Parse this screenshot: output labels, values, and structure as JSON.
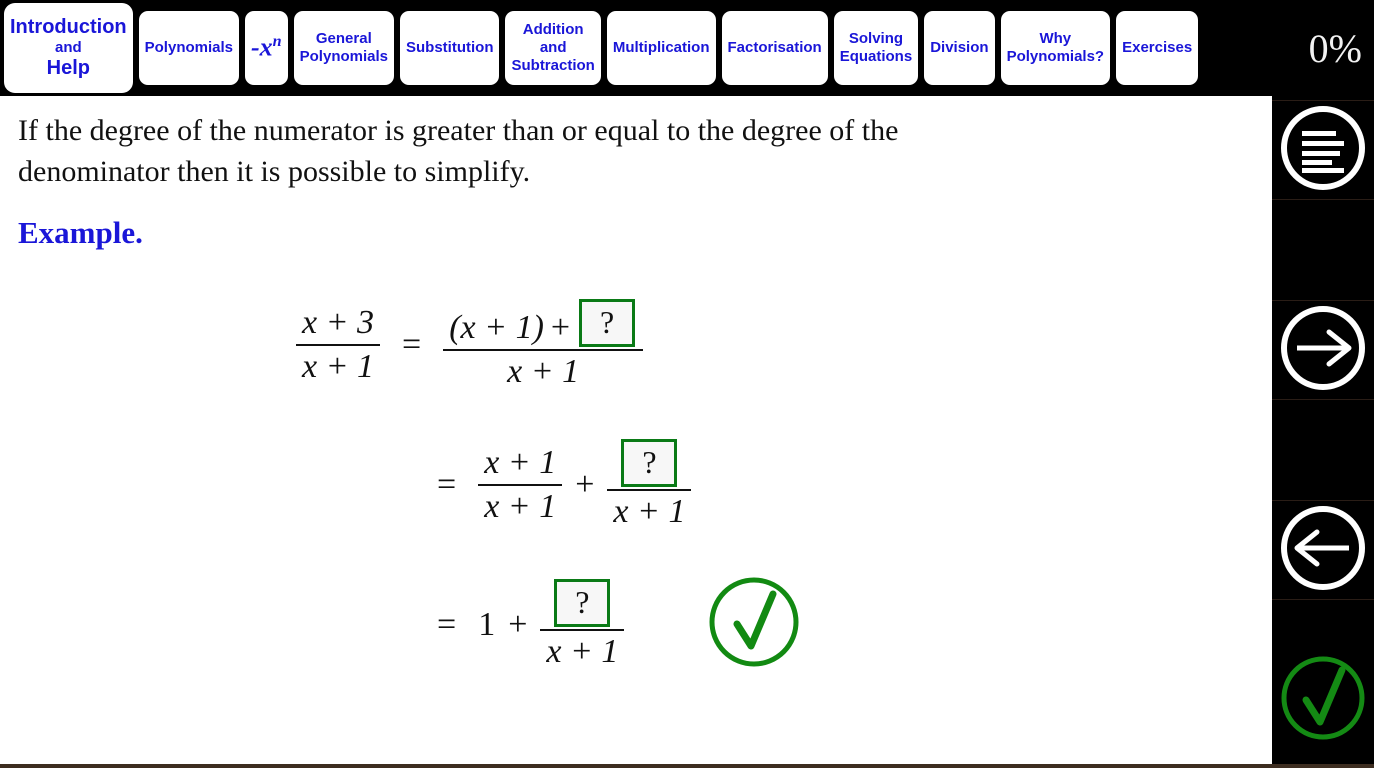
{
  "app": {
    "title": "Polynomials Interactive Lesson",
    "accent_blue": "#1a16d8",
    "accent_green": "#0a7a16",
    "tab_bg": "#ffffff",
    "chrome_bg": "#000000"
  },
  "tabs": [
    {
      "id": "introduction-and-help",
      "lines": [
        "Introduction",
        "and",
        "Help"
      ],
      "active": true,
      "math": false
    },
    {
      "id": "polynomials",
      "lines": [
        "Polynomials"
      ],
      "active": false,
      "math": false
    },
    {
      "id": "negative-x-power-n",
      "lines": [
        "-x"
      ],
      "superscript": "n",
      "active": false,
      "math": true
    },
    {
      "id": "general-polynomials",
      "lines": [
        "General",
        "Polynomials"
      ],
      "active": false,
      "math": false
    },
    {
      "id": "substitution",
      "lines": [
        "Substitution"
      ],
      "active": false,
      "math": false
    },
    {
      "id": "addition-and-subtraction",
      "lines": [
        "Addition",
        "and",
        "Subtraction"
      ],
      "active": false,
      "math": false
    },
    {
      "id": "multiplication",
      "lines": [
        "Multiplication"
      ],
      "active": false,
      "math": false
    },
    {
      "id": "factorisation",
      "lines": [
        "Factorisation"
      ],
      "active": false,
      "math": false
    },
    {
      "id": "solving-equations",
      "lines": [
        "Solving",
        "Equations"
      ],
      "active": false,
      "math": false
    },
    {
      "id": "division",
      "lines": [
        "Division"
      ],
      "active": false,
      "math": false
    },
    {
      "id": "why-polynomials",
      "lines": [
        "Why",
        "Polynomials?"
      ],
      "active": false,
      "math": false
    },
    {
      "id": "exercises",
      "lines": [
        "Exercises"
      ],
      "active": false,
      "math": false
    }
  ],
  "progress": {
    "label": "0%"
  },
  "slide": {
    "intro_text": "If the degree of the numerator is greater than or equal to the degree of the denominator then it is possible to simplify.",
    "example_label": "Example.",
    "equations": [
      {
        "id": "equation-1",
        "lhs": {
          "numerator": "x + 3",
          "denominator": "x + 1"
        },
        "equals": "=",
        "rhs": {
          "numerator_prefix": "(x + 1)",
          "numerator_op": "+",
          "numerator_blank": "?",
          "denominator": "x + 1"
        }
      },
      {
        "id": "equation-2",
        "equals": "=",
        "term1": {
          "numerator": "x + 1",
          "denominator": "x + 1"
        },
        "op": "+",
        "term2": {
          "numerator_blank": "?",
          "denominator": "x + 1"
        }
      },
      {
        "id": "equation-3",
        "equals": "=",
        "integer": "1",
        "op": "+",
        "term": {
          "numerator_blank": "?",
          "denominator": "x + 1"
        },
        "check_icon": "check-circle-icon"
      }
    ]
  },
  "sidebar": {
    "buttons": [
      {
        "id": "menu",
        "icon": "menu-lines-circle-icon",
        "color": "#ffffff"
      },
      {
        "id": "next",
        "icon": "arrow-right-circle-icon",
        "color": "#ffffff"
      },
      {
        "id": "previous",
        "icon": "arrow-left-circle-icon",
        "color": "#ffffff"
      },
      {
        "id": "check-answer",
        "icon": "check-circle-icon",
        "color": "#148a14"
      }
    ]
  }
}
